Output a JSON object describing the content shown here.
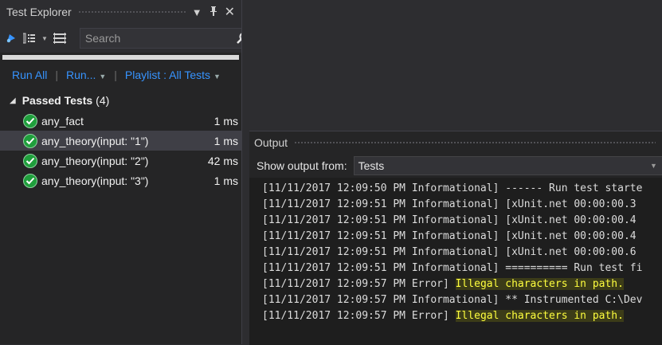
{
  "test_explorer": {
    "title": "Test Explorer",
    "title_icons": [
      "dropdown-caret-icon",
      "pin-icon",
      "close-icon"
    ],
    "toolbar_icons": [
      "run-tests-icon",
      "group-by-icon",
      "playlist-icon"
    ],
    "search": {
      "placeholder": "Search",
      "value": ""
    },
    "progress_fraction": 1.0,
    "actions": {
      "run_all": "Run All",
      "run": "Run...",
      "separator": "|",
      "playlist": "Playlist : All Tests"
    },
    "group": {
      "label": "Passed Tests",
      "count": "(4)"
    },
    "tests": [
      {
        "name": "any_fact",
        "duration": "1 ms",
        "selected": false
      },
      {
        "name": "any_theory(input: \"1\")",
        "duration": "1 ms",
        "selected": true
      },
      {
        "name": "any_theory(input: \"2\")",
        "duration": "42 ms",
        "selected": false
      },
      {
        "name": "any_theory(input: \"3\")",
        "duration": "1 ms",
        "selected": false
      }
    ]
  },
  "output": {
    "title": "Output",
    "show_from_label": "Show output from:",
    "source": "Tests",
    "lines": [
      {
        "prefix": "[11/11/2017 12:09:50 PM Informational] ",
        "text": "------ Run test starte",
        "highlight": false
      },
      {
        "prefix": "[11/11/2017 12:09:51 PM Informational] ",
        "text": "[xUnit.net 00:00:00.3",
        "highlight": false
      },
      {
        "prefix": "[11/11/2017 12:09:51 PM Informational] ",
        "text": "[xUnit.net 00:00:00.4",
        "highlight": false
      },
      {
        "prefix": "[11/11/2017 12:09:51 PM Informational] ",
        "text": "[xUnit.net 00:00:00.4",
        "highlight": false
      },
      {
        "prefix": "[11/11/2017 12:09:51 PM Informational] ",
        "text": "[xUnit.net 00:00:00.6",
        "highlight": false
      },
      {
        "prefix": "[11/11/2017 12:09:51 PM Informational] ",
        "text": "========== Run test fi",
        "highlight": false
      },
      {
        "prefix": "[11/11/2017 12:09:57 PM Error] ",
        "text": "Illegal characters in path.",
        "highlight": true
      },
      {
        "prefix": "[11/11/2017 12:09:57 PM Informational] ",
        "text": "** Instrumented C:\\Dev",
        "highlight": false
      },
      {
        "prefix": "[11/11/2017 12:09:57 PM Error] ",
        "text": "Illegal characters in path.",
        "highlight": true
      }
    ]
  },
  "colors": {
    "accent_link": "#3794ff",
    "passed": "#1f9f3c",
    "highlight_text": "#ffff3e",
    "background": "#2d2d30"
  }
}
